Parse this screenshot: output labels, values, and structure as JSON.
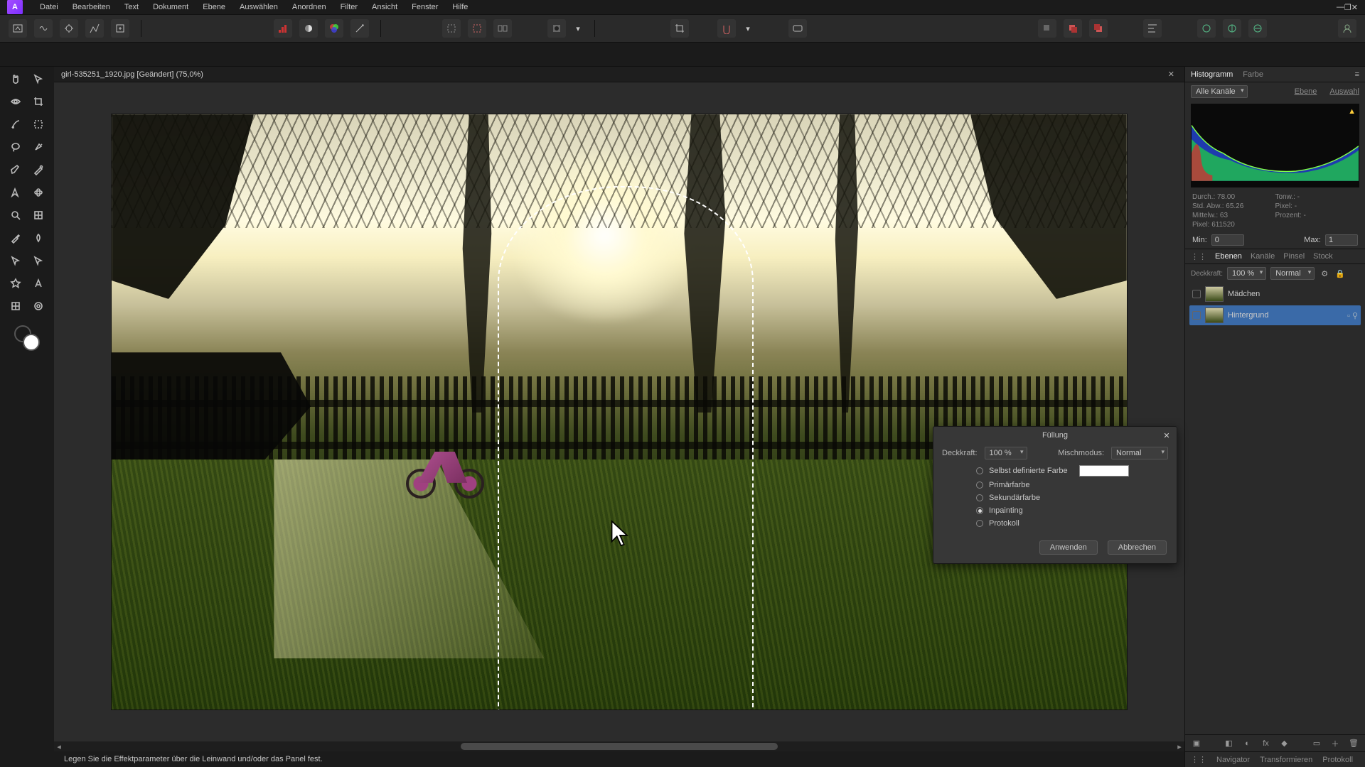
{
  "menu": {
    "items": [
      "Datei",
      "Bearbeiten",
      "Text",
      "Dokument",
      "Ebene",
      "Auswählen",
      "Anordnen",
      "Filter",
      "Ansicht",
      "Fenster",
      "Hilfe"
    ]
  },
  "doc": {
    "tab_label": "girl-535251_1920.jpg [Geändert] (75,0%)"
  },
  "status": {
    "hint": "Legen Sie die Effektparameter über die Leinwand und/oder das Panel fest."
  },
  "histogram": {
    "tabs": [
      "Histogramm",
      "Farbe"
    ],
    "channel_sel": "Alle Kanäle",
    "links": [
      "Ebene",
      "Auswahl"
    ],
    "stats": {
      "durch": "Durch.: 78.00",
      "stdabw": "Std. Abw.: 65.26",
      "mittelw": "Mittelw.: 63",
      "pixel": "Pixel: 611520",
      "tonw": "Tonw.: -",
      "pixel2": "Pixel: -",
      "prozent": "Prozent: -"
    },
    "min_label": "Min:",
    "min_val": "0",
    "max_label": "Max:",
    "max_val": "1"
  },
  "layers_panel": {
    "tabs": [
      "Ebenen",
      "Kanäle",
      "Pinsel",
      "Stock"
    ],
    "opacity_label": "Deckkraft:",
    "opacity_val": "100 %",
    "blend_val": "Normal",
    "layers": [
      {
        "name": "Mädchen"
      },
      {
        "name": "Hintergrund"
      }
    ]
  },
  "footer_tabs": [
    "Navigator",
    "Transformieren",
    "Protokoll"
  ],
  "dialog": {
    "title": "Füllung",
    "opacity_label": "Deckkraft:",
    "opacity_val": "100 %",
    "blend_label": "Mischmodus:",
    "blend_val": "Normal",
    "options": [
      "Selbst definierte Farbe",
      "Primärfarbe",
      "Sekundärfarbe",
      "Inpainting",
      "Protokoll"
    ],
    "selected_index": 3,
    "apply": "Anwenden",
    "cancel": "Abbrechen"
  }
}
